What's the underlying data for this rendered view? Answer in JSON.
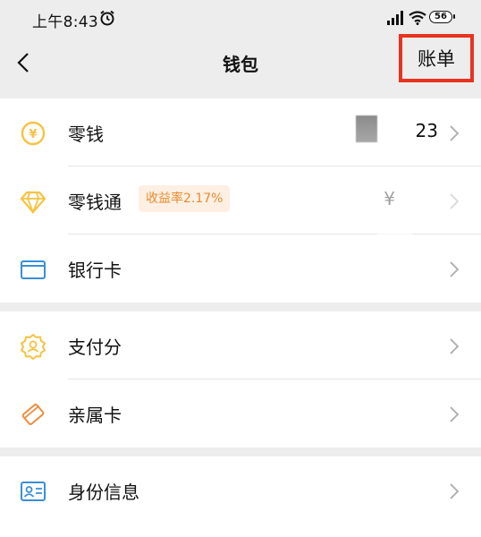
{
  "status_bar": {
    "time": "上午8:43",
    "battery": "56"
  },
  "header": {
    "title": "钱包",
    "bill_label": "账单"
  },
  "groups": [
    {
      "items": [
        {
          "label": "零钱",
          "value": "23",
          "icon": "yuan-coin-icon"
        },
        {
          "label": "零钱通",
          "badge": "收益率2.17%",
          "value": "¥",
          "icon": "diamond-icon"
        },
        {
          "label": "银行卡",
          "icon": "bank-card-icon"
        }
      ]
    },
    {
      "items": [
        {
          "label": "支付分",
          "icon": "payment-score-icon"
        },
        {
          "label": "亲属卡",
          "icon": "family-card-icon"
        }
      ]
    },
    {
      "items": [
        {
          "label": "身份信息",
          "icon": "id-card-icon"
        }
      ]
    }
  ],
  "colors": {
    "accent_yellow": "#f6c342",
    "accent_orange": "#ee8d3d",
    "bank_blue": "#3a8fd6",
    "highlight_red": "#e8331f",
    "badge_bg": "#fdf0e3",
    "badge_text": "#e98b2f"
  }
}
